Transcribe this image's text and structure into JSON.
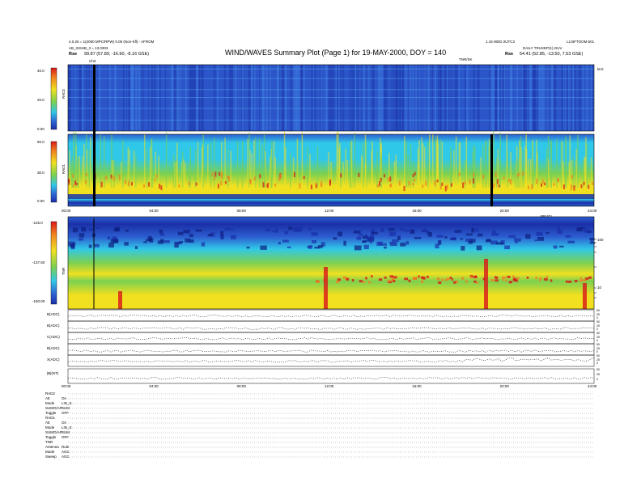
{
  "header": {
    "title": "WIND/WAVES Summary Plot (Page 1) for 19-MAY-2000, DOY = 140",
    "line1_left": "4.0.26 = 1(2000 MPC/RPW) 0.05 (Non-Kfl) - AFROM",
    "line2_left": "AB_ISSHB_3 = 13.0303",
    "rpos_label": "Rse",
    "rpos_left": "99.87 (57.89, -16.90, -8.16 GSE)",
    "line1_right": "1.15 WED 2UTC3",
    "line1_right2": "L2.BFTOOM.b01",
    "line2_right": "DAILY TRUXEP(1).OUV",
    "rpos_right": "54.41 (52.85, -13.50, 7.53 GSE)",
    "tnr_mark": "TNR/SK",
    "ha_label": "Ch3",
    "top_right_unit": "kHz"
  },
  "panels": {
    "rad2": {
      "name": "RAD2",
      "ticks": [
        "40.0",
        "20.0",
        "0.00"
      ]
    },
    "rad1": {
      "name": "RAD1",
      "ticks": [
        "60.0",
        "30.0",
        "0.00"
      ]
    },
    "tnr": {
      "name": "TNR",
      "ticks": [
        "-125.0",
        "-137.50",
        "-150.00"
      ],
      "right_ticks": [
        "100",
        "10"
      ],
      "top_right_label": "BEVGL"
    }
  },
  "time_ticks": [
    "00:00",
    "04:00",
    "08:00",
    "12:00",
    "16:00",
    "20:00",
    "24:00"
  ],
  "stack_labels": [
    "B(ADC)",
    "B(ADC)",
    "C(ADC)",
    "B(ADC)",
    "X(ADC)",
    "|B|(NT)"
  ],
  "right_axis_labels": [
    "50",
    "25",
    "0",
    "50",
    "25",
    "0",
    "50",
    "25",
    "0",
    "50",
    "25",
    "0",
    "50",
    "25",
    "0",
    "50",
    "25",
    "0"
  ],
  "footer": {
    "blocks": [
      {
        "title": "RAD2",
        "rows": [
          [
            "Att",
            "On"
          ],
          [
            "Mode",
            "LIN_S"
          ],
          [
            "SUMO/AP",
            "SUM"
          ],
          [
            "Toggle",
            "OFF"
          ]
        ]
      },
      {
        "title": "RAD1",
        "rows": [
          [
            "Att",
            "On"
          ],
          [
            "Mode",
            "LIN_S"
          ],
          [
            "SUMO/AP",
            "SUM"
          ],
          [
            "Toggle",
            "OFF"
          ]
        ]
      },
      {
        "title": "TNR",
        "rows": [
          [
            "Antenna",
            "Rule"
          ],
          [
            "Mode",
            "AGC"
          ],
          [
            "Sweep",
            "AGC"
          ]
        ]
      }
    ]
  },
  "colors": {
    "deep_blue": "#1a2fa8",
    "mid_blue": "#2d5fd0",
    "cyan": "#30c8e8",
    "green": "#7cd050",
    "yellow": "#f0e020",
    "orange": "#f08020",
    "red": "#d81818"
  }
}
